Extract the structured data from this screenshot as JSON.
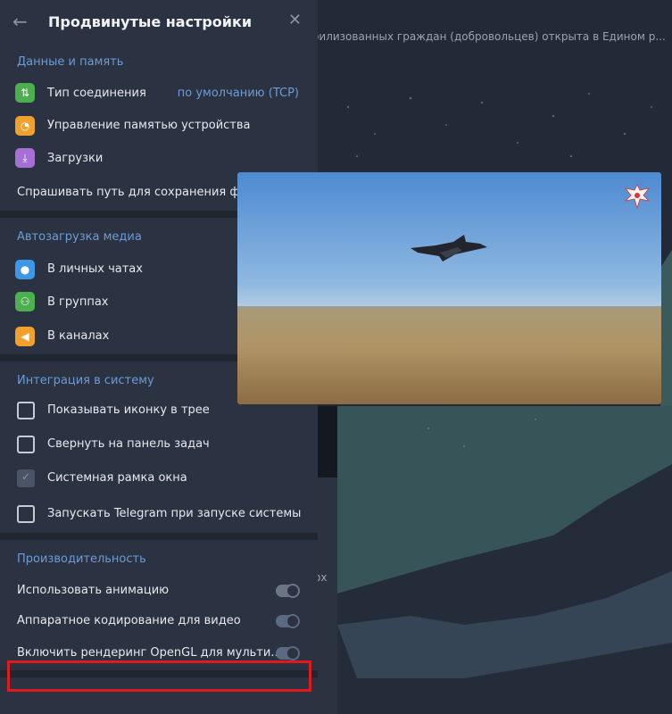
{
  "background": {
    "header_text": "билизованных граждан (добровольцев) открыта в Едином р..."
  },
  "panel": {
    "title": "Продвинутые настройки",
    "back_icon": "arrow-left-icon",
    "close_icon": "close-icon"
  },
  "data_memory": {
    "title": "Данные и память",
    "connection_type": {
      "label": "Тип соединения",
      "value": "по умолчанию (TCP)"
    },
    "storage": {
      "label": "Управление памятью устройства"
    },
    "downloads": {
      "label": "Загрузки"
    },
    "ask_path": {
      "label": "Спрашивать путь для сохранения файл"
    }
  },
  "autoload": {
    "title": "Автозагрузка медиа",
    "private": "В личных чатах",
    "groups": "В группах",
    "channels": "В каналах"
  },
  "integration": {
    "title": "Интеграция в систему",
    "tray": {
      "label": "Показывать иконку в трее",
      "checked": false
    },
    "taskbar": {
      "label": "Свернуть на панель задач",
      "checked": false
    },
    "frame": {
      "label": "Системная рамка окна",
      "checked": true
    },
    "autostart": {
      "label": "Запускать Telegram при запуске системы",
      "checked": false
    }
  },
  "performance": {
    "title": "Производительность",
    "animation": {
      "label": "Использовать анимацию",
      "enabled": true
    },
    "hw_encode": {
      "label": "Аппаратное кодирование для видео",
      "enabled": true
    },
    "opengl": {
      "label": "Включить рендеринг OpenGL для мульти...",
      "enabled": true
    }
  },
  "colors": {
    "accent": "#6c9bd6",
    "highlight_border": "#e01a1a",
    "panel_bg": "#2b3342"
  },
  "background_extra": {
    "side_text": "ох"
  }
}
